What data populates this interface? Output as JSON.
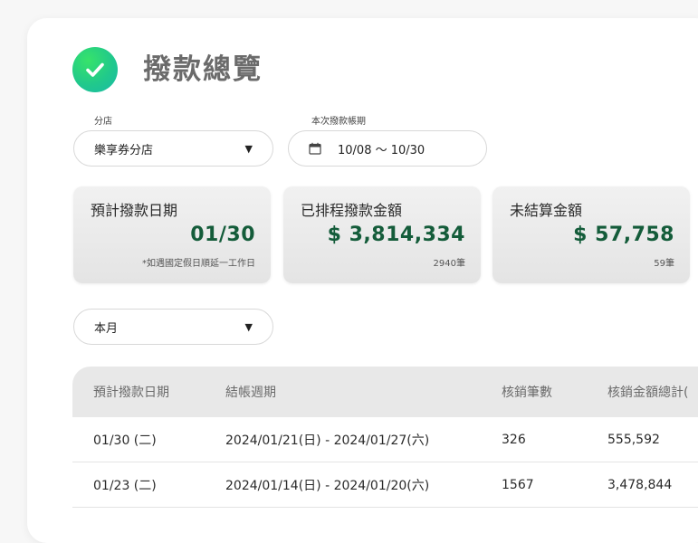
{
  "header": {
    "title": "撥款總覽",
    "icon": "check-circle-icon"
  },
  "filters": {
    "branch_label": "分店",
    "branch_value": "樂享券分店",
    "period_label": "本次撥款帳期",
    "period_value": "10/08 ～ 10/30",
    "range_value": "本月"
  },
  "stats": [
    {
      "label": "預計撥款日期",
      "value": "01/30",
      "sub": "*如遇國定假日順延一工作日"
    },
    {
      "label": "已排程撥款金額",
      "value": "$ 3,814,334",
      "sub": "2940筆"
    },
    {
      "label": "未結算金額",
      "value": "$ 57,758",
      "sub": "59筆"
    }
  ],
  "table": {
    "headers": [
      "預計撥款日期",
      "結帳週期",
      "核銷筆數",
      "核銷金額總計("
    ],
    "rows": [
      [
        "01/30 (二)",
        "2024/01/21(日) - 2024/01/27(六)",
        "326",
        "555,592"
      ],
      [
        "01/23 (二)",
        "2024/01/14(日) - 2024/01/20(六)",
        "1567",
        "3,478,844"
      ]
    ]
  },
  "colors": {
    "accent_green": "#21c98b",
    "value_green": "#145c3a"
  }
}
